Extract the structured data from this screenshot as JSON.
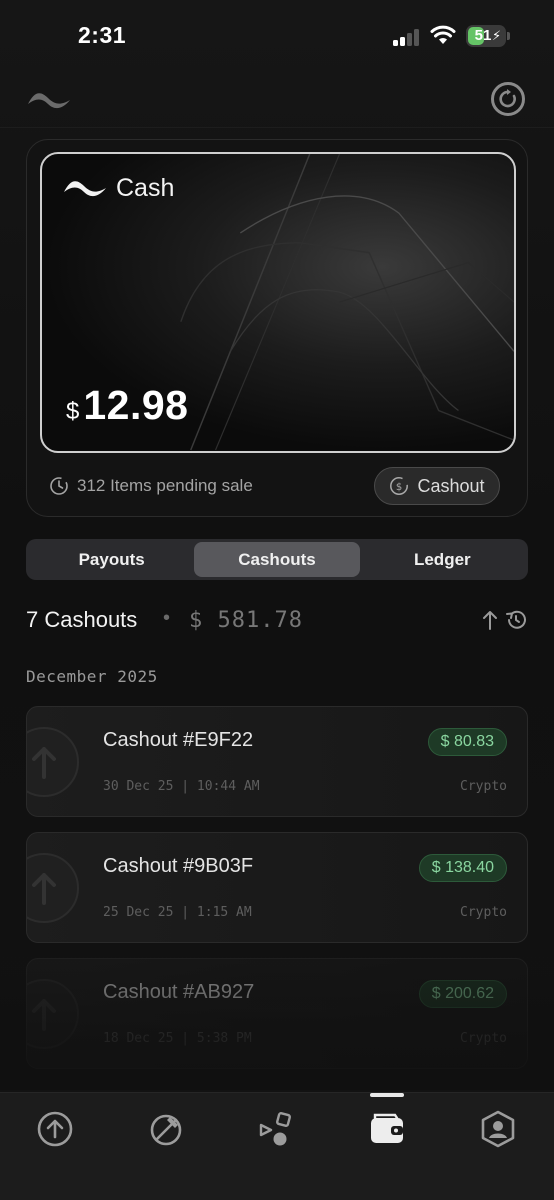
{
  "status_bar": {
    "time": "2:31",
    "battery_percent": 51,
    "battery_text": "51",
    "signal_bars": 2,
    "battery_color": "#65c466"
  },
  "header": {
    "logo_icon": "brand-wave-icon",
    "refresh_icon": "refresh-icon"
  },
  "wallet": {
    "brand_name": "Cash",
    "currency_symbol": "$",
    "balance": "12.98",
    "pending_text": "312 Items pending sale",
    "pending_icon": "clock-icon",
    "cashout_button_label": "Cashout",
    "cashout_button_icon": "dollar-circle-icon"
  },
  "tabs": [
    {
      "label": "Payouts",
      "active": false
    },
    {
      "label": "Cashouts",
      "active": true
    },
    {
      "label": "Ledger",
      "active": false
    }
  ],
  "summary": {
    "count_label": "7 Cashouts",
    "separator": "•",
    "total": "$ 581.78"
  },
  "month_label": "December 2025",
  "cashouts": [
    {
      "title": "Cashout #E9F22",
      "amount": "$ 80.83",
      "meta": "30 Dec 25 | 10:44 AM",
      "method": "Crypto"
    },
    {
      "title": "Cashout #9B03F",
      "amount": "$ 138.40",
      "meta": "25 Dec 25 | 1:15 AM",
      "method": "Crypto"
    },
    {
      "title": "Cashout #AB927",
      "amount": "$ 200.62",
      "meta": "18 Dec 25 | 5:38 PM",
      "method": "Crypto"
    }
  ],
  "bottom_nav": [
    {
      "name": "upload-icon",
      "active": false
    },
    {
      "name": "no-edit-icon",
      "active": false
    },
    {
      "name": "shapes-icon",
      "active": false
    },
    {
      "name": "wallet-icon",
      "active": true
    },
    {
      "name": "profile-shield-icon",
      "active": false
    }
  ],
  "colors": {
    "background": "#0f0f0f",
    "accent_green": "#8ad6a0",
    "active_tab": "#58585c"
  }
}
